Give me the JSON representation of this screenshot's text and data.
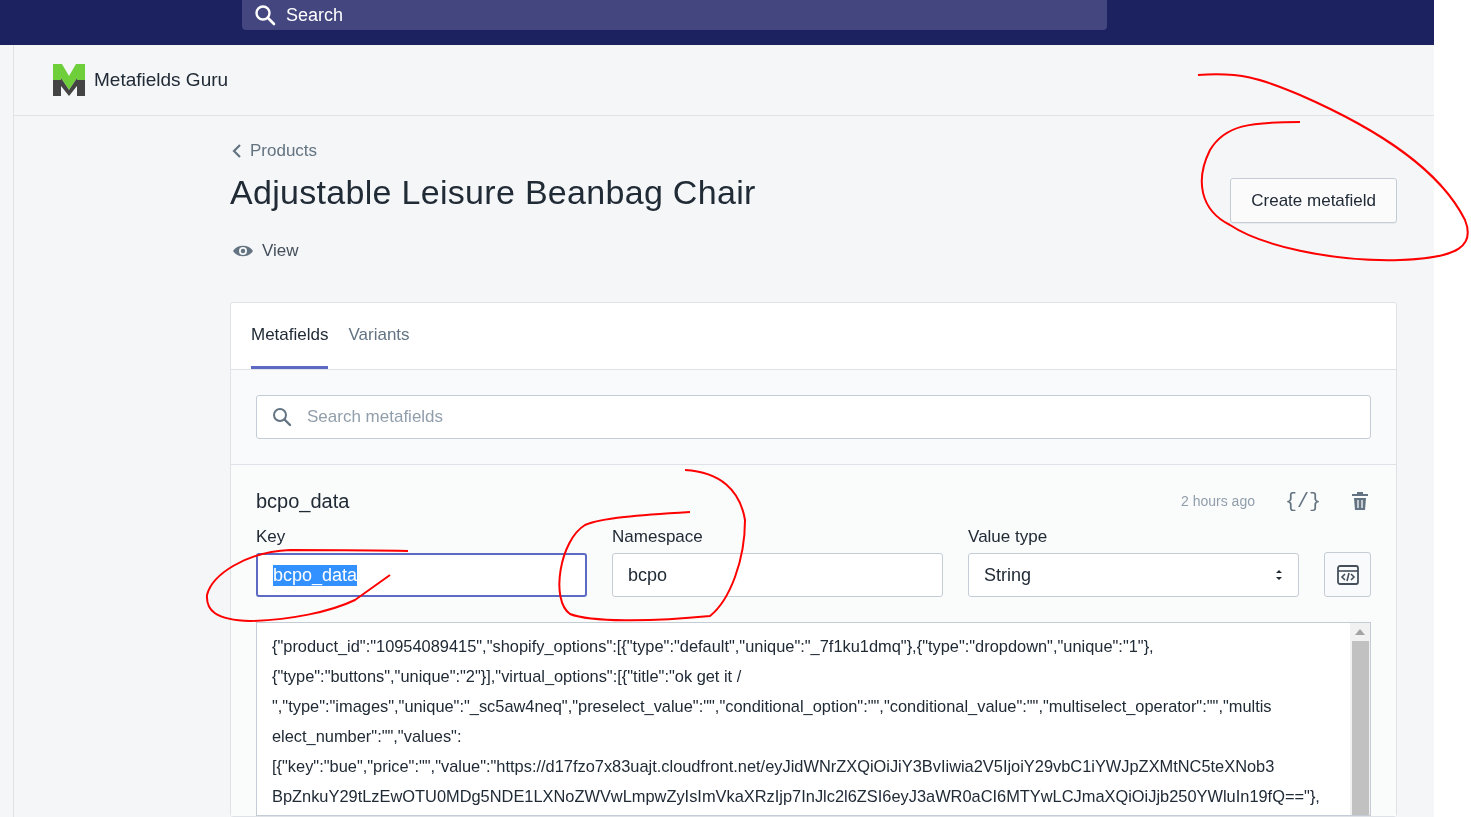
{
  "top_bar": {
    "search": {
      "placeholder": "Search"
    }
  },
  "app_header": {
    "app_name": "Metafields Guru"
  },
  "page": {
    "breadcrumb": "Products",
    "title": "Adjustable Leisure Beanbag Chair",
    "view_link": "View",
    "primary_action": "Create metafield"
  },
  "tabs": [
    {
      "label": "Metafields",
      "selected": true
    },
    {
      "label": "Variants",
      "selected": false
    }
  ],
  "metafield_search": {
    "placeholder": "Search metafields"
  },
  "metafield": {
    "name": "bcpo_data",
    "updated": "2 hours ago",
    "code_toggle": "{/}",
    "fields": [
      {
        "kind": "text",
        "label": "Key",
        "value": "bcpo_data",
        "focused": true
      },
      {
        "kind": "text",
        "label": "Namespace",
        "value": "bcpo",
        "focused": false
      },
      {
        "kind": "select",
        "label": "Value type",
        "value": "String",
        "focused": false
      }
    ],
    "value_lines": [
      "{\"product_id\":\"10954089415\",\"shopify_options\":[{\"type\":\"default\",\"unique\":\"_7f1ku1dmq\"},{\"type\":\"dropdown\",\"unique\":\"1\"},",
      "{\"type\":\"buttons\",\"unique\":\"2\"}],\"virtual_options\":[{\"title\":\"ok get it /",
      "\",\"type\":\"images\",\"unique\":\"_sc5aw4neq\",\"preselect_value\":\"\",\"conditional_option\":\"\",\"conditional_value\":\"\",\"multiselect_operator\":\"\",\"multis",
      "elect_number\":\"\",\"values\":",
      "[{\"key\":\"bue\",\"price\":\"\",\"value\":\"https://d17fzo7x83uajt.cloudfront.net/eyJidWNrZXQiOiJiY3BvIiwia2V5IjoiY29vbC1iYWJpZXMtNC5teXNob3",
      "BpZnkuY29tLzEwOTU0MDg5NDE1LXNoZWVwLmpwZyIsImVkaXRzIjp7InJlc2l6ZSI6eyJ3aWR0aCI6MTYwLCJmaXQiOiJjb250YWluIn19fQ==\"},"
    ]
  }
}
